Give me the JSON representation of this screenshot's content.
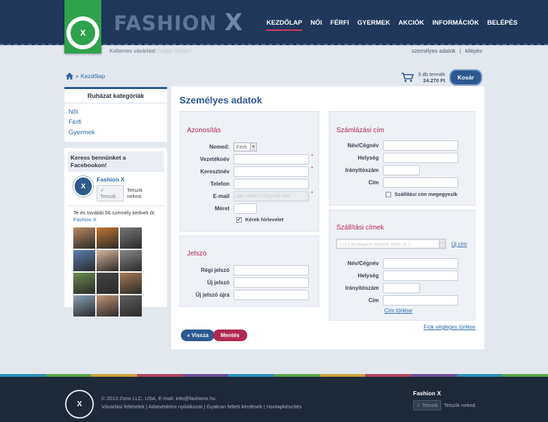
{
  "header": {
    "brand": "FASHION",
    "brand_x": "X",
    "logo_letter": "X",
    "nav": [
      "KEZDŐLAP",
      "NŐI",
      "FÉRFI",
      "GYERMEK",
      "AKCIÓK",
      "INFORMÁCIÓK",
      "BELÉPÉS"
    ],
    "active_nav": "KEZDŐLAP"
  },
  "subbar": {
    "welcome": "Kellemes vásárlást",
    "welcome_name": "Szabó Zoltán!",
    "links": [
      "személyes adatok",
      "kilépés"
    ],
    "separator": "|"
  },
  "breadcrumb": {
    "sep": "»",
    "current": "Kezdőlap"
  },
  "cart": {
    "items": "3 db termék",
    "total": "24.270 Ft",
    "button": "Kosár"
  },
  "categories": {
    "title": "Ruházat kategóriák",
    "items": [
      "Női",
      "Férfi",
      "Gyermek"
    ]
  },
  "facebook": {
    "heading": "Keress bennünket a Facebookon!",
    "page_name": "Fashion X",
    "like_button": "✓ Tetszik",
    "like_text": "Tetszik neked.",
    "count_text": "Te és további 56 személy kedveli őt:",
    "count_link": "Fashion X",
    "photo_colors": [
      "#b98a5e",
      "#c4762f",
      "#777",
      "#5a7fb2",
      "#d6b59a",
      "#888",
      "#6b8c4f",
      "#444",
      "#a57955",
      "#8aa3b8",
      "#c49478",
      "#5e5e5e"
    ]
  },
  "main": {
    "title": "Személyes adatok",
    "identity": {
      "title": "Azonosítás",
      "labels": {
        "gender": "Nemed:",
        "last_name": "Vezetéknév",
        "first_name": "Keresztnév",
        "phone": "Telefon",
        "email": "E-mail",
        "size": "Méret"
      },
      "gender_value": "Férfi",
      "email_value": "gaz.zoltan73@gmail.com",
      "newsletter_label": "Kérek hírlevelet",
      "newsletter_checked": true,
      "required_mark": "*"
    },
    "password": {
      "title": "Jelszó",
      "labels": {
        "old": "Régi jelszó",
        "new": "Új jelszó",
        "repeat": "Új jelszó újra"
      }
    },
    "billing": {
      "title": "Számlázási cím",
      "labels": {
        "name": "Név/Cégnév",
        "city": "Helység",
        "zip": "Irányítószám",
        "address": "Cím"
      },
      "same_label": "Szállítási cím megegyezik"
    },
    "shipping": {
      "title": "Szállítási címek",
      "select_value": "1114 Budapest Bartók Béla út 1.",
      "new_link": "Új cím",
      "labels": {
        "name": "Név/Cégnév",
        "city": "Helység",
        "zip": "Irányítószám",
        "address": "Cím"
      },
      "delete_link": "Cím törlése"
    },
    "delete_account": "Fiók végleges törlése",
    "back_button": "« Vissza",
    "save_button": "Mentés"
  },
  "footer": {
    "copyright": "© 2013 Zono LLC. USA, E-mail: info@fashionx.hu",
    "links": "Vásárlási feltételek | Adatvédelmi nyilatkozat | Gyakran feltett kérdések | Honlapkészítés",
    "fb_name": "Fashion X",
    "like_button": "✓ Tetszik",
    "like_text": "Tetszik neked.",
    "stripe_colors": [
      "#2b8fb5",
      "#5ba44a",
      "#c7a13a",
      "#b04660",
      "#6a4c8f",
      "#2b8fb5",
      "#5ba44a",
      "#c7a13a",
      "#b04660",
      "#6a4c8f",
      "#2b8fb5",
      "#5ba44a"
    ]
  }
}
